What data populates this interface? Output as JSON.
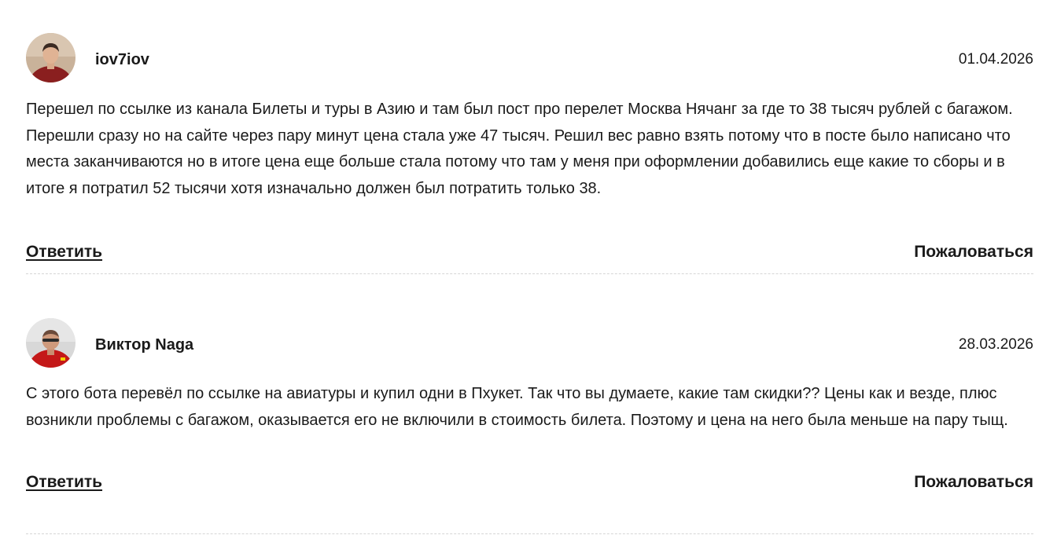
{
  "comments": [
    {
      "author": "iov7iov",
      "date": "01.04.2026",
      "text": "Перешел по ссылке из канала Билеты и туры в Азию и там был пост про перелет Москва Нячанг за где то 38 тысяч рублей с багажом. Перешли сразу но на сайте через пару минут цена стала уже 47 тысяч. Решил вес равно взять потому что в посте было написано что места заканчиваются но в итоге цена еще больше стала потому что там у меня при оформлении добавились еще какие то сборы и в итоге я потратил 52 тысячи хотя изначально должен был потратить только 38.",
      "reply_label": "Ответить",
      "report_label": "Пожаловаться",
      "avatar_icon": "user-photo-avatar"
    },
    {
      "author": "Виктор Naga",
      "date": "28.03.2026",
      "text": "С этого бота перевёл по ссылке на авиатуры и купил одни в Пхукет. Так что вы думаете, какие там скидки?? Цены как и везде, плюс возникли проблемы с багажом, оказывается его не включили в стоимость билета. Поэтому и цена на него была меньше на пару тыщ.",
      "reply_label": "Ответить",
      "report_label": "Пожаловаться",
      "avatar_icon": "user-photo-avatar"
    }
  ],
  "colors": {
    "text": "#1a1a1a",
    "divider": "#d6d6d6",
    "background": "#ffffff"
  }
}
